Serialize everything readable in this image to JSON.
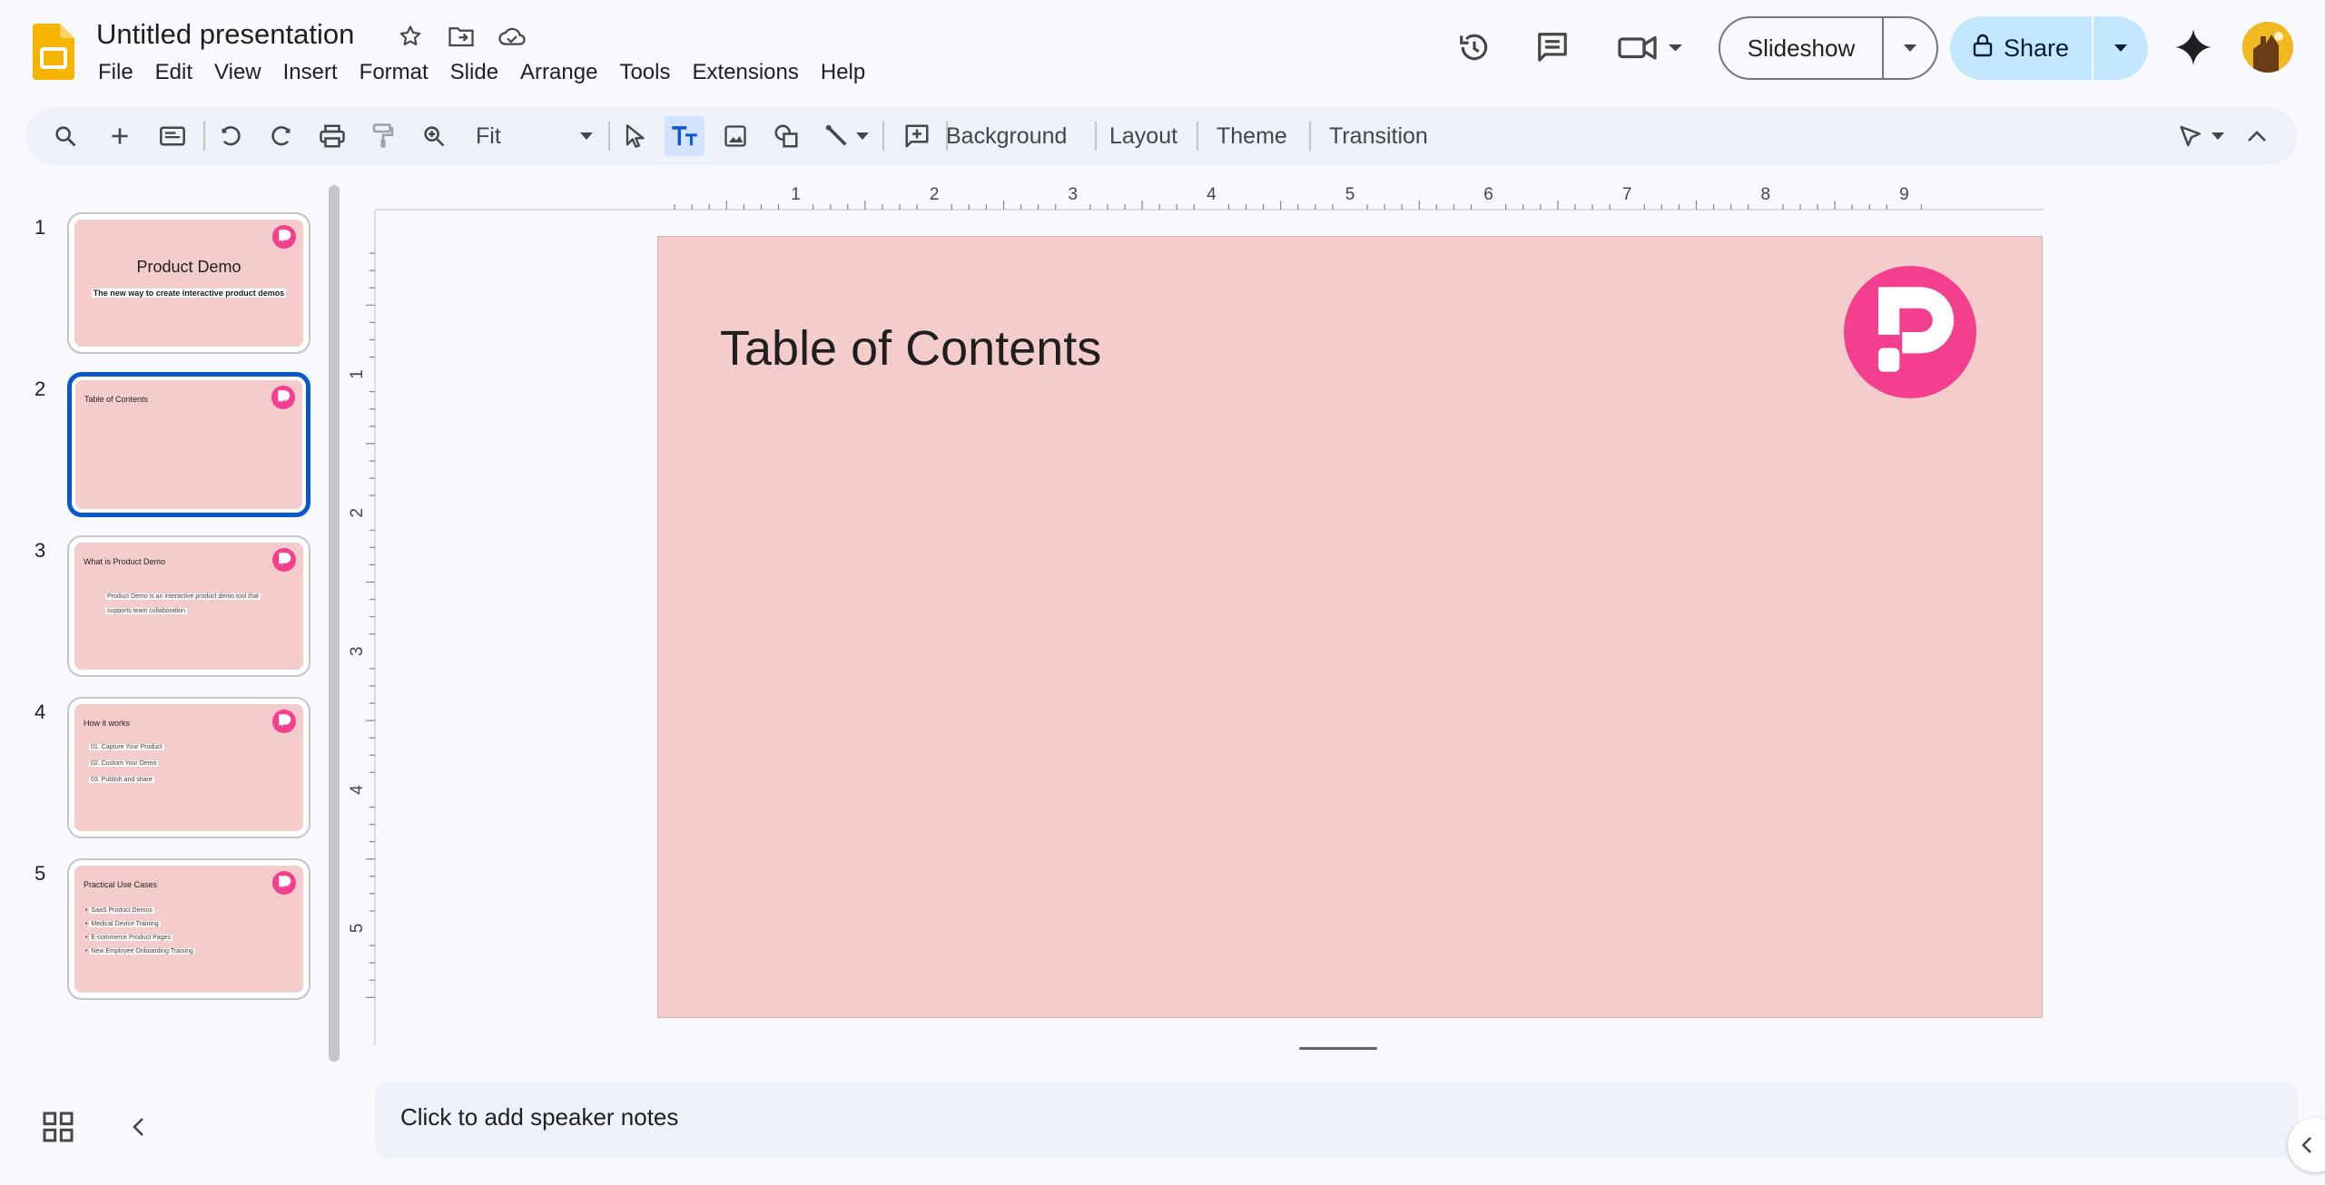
{
  "document": {
    "title": "Untitled presentation"
  },
  "menu": [
    "File",
    "Edit",
    "View",
    "Insert",
    "Format",
    "Slide",
    "Arrange",
    "Tools",
    "Extensions",
    "Help"
  ],
  "header": {
    "slideshow_label": "Slideshow",
    "share_label": "Share"
  },
  "toolbar": {
    "zoom_value": "Fit",
    "background_label": "Background",
    "layout_label": "Layout",
    "theme_label": "Theme",
    "transition_label": "Transition"
  },
  "filmstrip": {
    "slides": [
      {
        "number": "1",
        "title": "Product Demo",
        "subtitle": "The new way to create interactive product demos"
      },
      {
        "number": "2",
        "title": "Table of Contents"
      },
      {
        "number": "3",
        "title": "What is Product Demo",
        "lines": [
          "Product Demo is an interactive product demo tool that",
          "supports team collaboration"
        ]
      },
      {
        "number": "4",
        "title": "How it works",
        "lines": [
          "01. Capture Your Product",
          "02. Custom Your Demo",
          "03. Publish and share"
        ]
      },
      {
        "number": "5",
        "title": "Practical Use Cases",
        "bullets": [
          "SaaS Product Demos",
          "Medical Device Training",
          "E-commerce Product Pages",
          "New Employee Onboarding Training"
        ]
      }
    ],
    "selected_index": 2
  },
  "rulers": {
    "horizontal_labels": [
      "1",
      "2",
      "3",
      "4",
      "5",
      "6",
      "7",
      "8",
      "9"
    ],
    "vertical_labels": [
      "1",
      "2",
      "3",
      "4",
      "5"
    ]
  },
  "slide": {
    "title": "Table of Contents"
  },
  "notes": {
    "placeholder": "Click to add speaker notes"
  },
  "colors": {
    "slide_background": "#f4cccc",
    "logo_pink": "#f43f8e",
    "accent_blue": "#0b57d0",
    "share_bg": "#c2e7ff"
  },
  "icons": [
    "slides-logo-icon",
    "star-icon",
    "move-folder-icon",
    "cloud-status-icon",
    "history-icon",
    "comments-icon",
    "meet-icon",
    "gemini-icon",
    "lock-icon"
  ]
}
